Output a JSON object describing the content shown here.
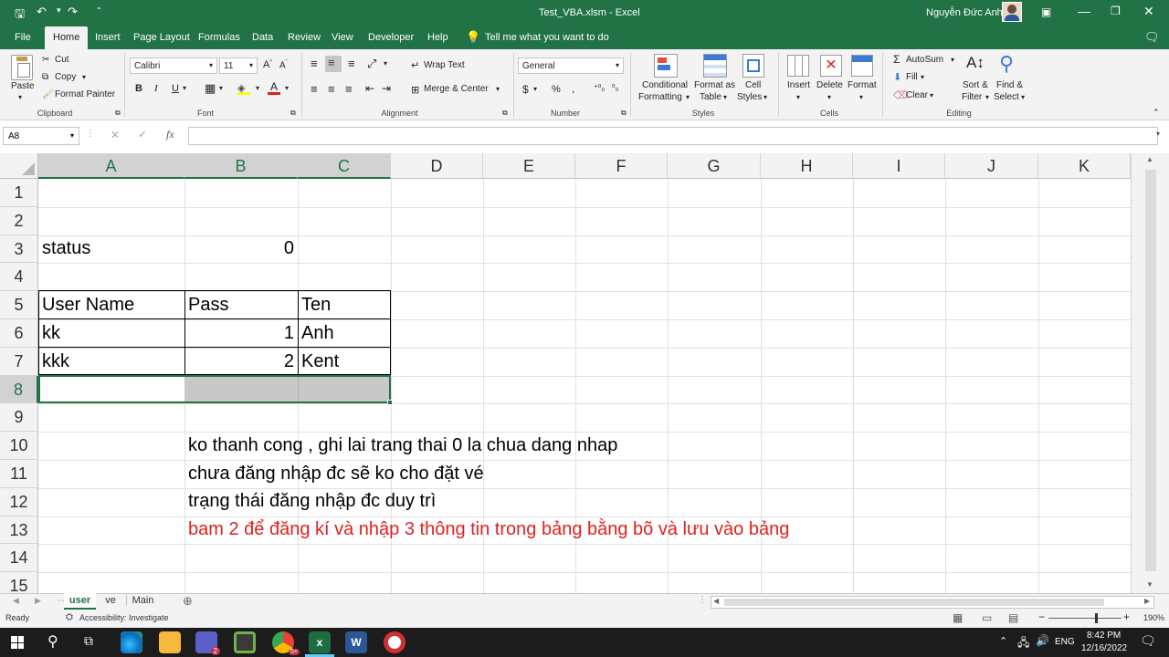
{
  "window": {
    "file_title": "Test_VBA.xlsm",
    "separator": "-",
    "app_name": "Excel",
    "user_name": "Nguyễn Đức Anh"
  },
  "menu": [
    "File",
    "Home",
    "Insert",
    "Page Layout",
    "Formulas",
    "Data",
    "Review",
    "View",
    "Developer",
    "Help"
  ],
  "tell_me": "Tell me what you want to do",
  "ribbon": {
    "clipboard": {
      "paste": "Paste",
      "cut": "Cut",
      "copy": "Copy",
      "format_painter": "Format Painter",
      "label": "Clipboard"
    },
    "font": {
      "name": "Calibri",
      "size": "11",
      "label": "Font"
    },
    "alignment": {
      "wrap": "Wrap Text",
      "merge": "Merge & Center",
      "label": "Alignment"
    },
    "number": {
      "format": "General",
      "label": "Number"
    },
    "styles": {
      "conditional1": "Conditional",
      "conditional2": "Formatting",
      "format_as1": "Format as",
      "format_as2": "Table",
      "cell_styles1": "Cell",
      "cell_styles2": "Styles",
      "label": "Styles"
    },
    "cells": {
      "insert": "Insert",
      "delete": "Delete",
      "format": "Format",
      "label": "Cells"
    },
    "editing": {
      "autosum": "AutoSum",
      "fill": "Fill",
      "clear": "Clear",
      "sort1": "Sort &",
      "sort2": "Filter",
      "find1": "Find &",
      "find2": "Select",
      "label": "Editing"
    }
  },
  "formula_bar": {
    "name_box": "A8",
    "fx": "fx",
    "formula": ""
  },
  "columns": [
    "A",
    "B",
    "C",
    "D",
    "E",
    "F",
    "G",
    "H",
    "I",
    "J",
    "K"
  ],
  "rows": [
    "1",
    "2",
    "3",
    "4",
    "5",
    "6",
    "7",
    "8",
    "9",
    "10",
    "11",
    "12",
    "13",
    "14",
    "15"
  ],
  "cells": {
    "A3": "status",
    "B3": "0",
    "A5": "User Name",
    "B5": "Pass",
    "C5": "Ten",
    "A6": "kk",
    "B6": "1",
    "C6": "Anh",
    "A7": "kkk",
    "B7": "2",
    "C7": "Kent",
    "B10": "ko thanh cong , ghi lai trang thai 0 la chua dang nhap",
    "B11": "chưa đăng nhập đc sẽ ko cho đặt vé",
    "B12": "trạng thái đăng nhập đc duy trì",
    "B13": "bam 2 để đăng kí và nhập 3 thông tin trong bảng bằng bõ và lưu vào bảng"
  },
  "colors": {
    "excel_green": "#217346",
    "note_red": "#e02020"
  },
  "sheets": [
    "user",
    "ve",
    "Main"
  ],
  "status": {
    "ready": "Ready",
    "accessibility": "Accessibility: Investigate",
    "zoom": "190%"
  },
  "taskbar": {
    "lang": "ENG",
    "time": "8:42 PM",
    "date": "12/16/2022",
    "badge_teams": "2",
    "badge_chrome": "5+"
  }
}
